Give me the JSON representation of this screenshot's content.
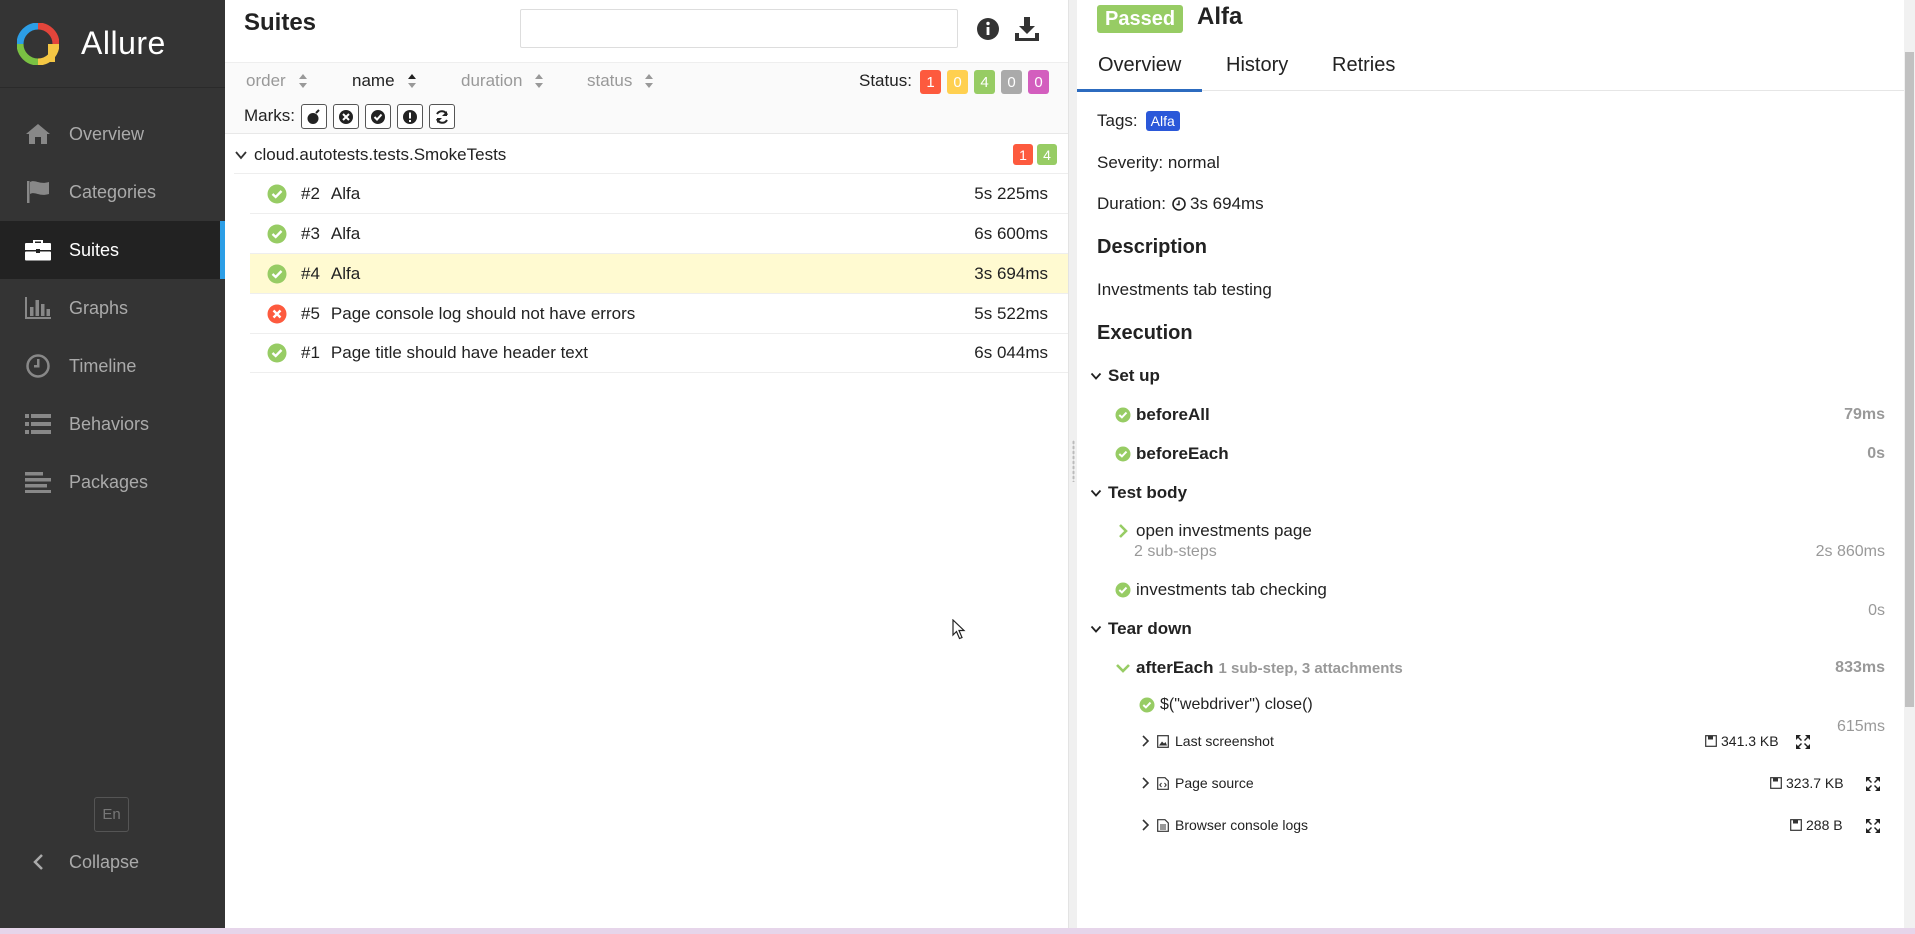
{
  "sidebar": {
    "brand": "Allure",
    "items": [
      {
        "label": "Overview",
        "icon": "home-icon"
      },
      {
        "label": "Categories",
        "icon": "flag-icon"
      },
      {
        "label": "Suites",
        "icon": "briefcase-icon",
        "active": true
      },
      {
        "label": "Graphs",
        "icon": "bar-chart-icon"
      },
      {
        "label": "Timeline",
        "icon": "clock-icon"
      },
      {
        "label": "Behaviors",
        "icon": "list-icon"
      },
      {
        "label": "Packages",
        "icon": "align-left-icon"
      }
    ],
    "language": "En",
    "collapse_label": "Collapse"
  },
  "suites": {
    "title": "Suites",
    "search": {
      "value": "",
      "placeholder": ""
    },
    "sort": {
      "order": "order",
      "name": "name",
      "duration": "duration",
      "status": "status"
    },
    "status_label": "Status:",
    "status_counts": [
      {
        "value": "1",
        "color": "#fd5a3e"
      },
      {
        "value": "0",
        "color": "#ffd050"
      },
      {
        "value": "4",
        "color": "#97cc64"
      },
      {
        "value": "0",
        "color": "#aaaaaa"
      },
      {
        "value": "0",
        "color": "#d35ebe"
      }
    ],
    "marks_label": "Marks:",
    "group": {
      "name": "cloud.autotests.tests.SmokeTests",
      "failed": "1",
      "passed": "4"
    },
    "rows": [
      {
        "num": "#2",
        "name": "Alfa",
        "duration": "5s 225ms",
        "status": "passed"
      },
      {
        "num": "#3",
        "name": "Alfa",
        "duration": "6s 600ms",
        "status": "passed"
      },
      {
        "num": "#4",
        "name": "Alfa",
        "duration": "3s 694ms",
        "status": "passed"
      },
      {
        "num": "#5",
        "name": "Page console log should not have errors",
        "duration": "5s 522ms",
        "status": "failed"
      },
      {
        "num": "#1",
        "name": "Page title should have header text",
        "duration": "6s 044ms",
        "status": "passed"
      }
    ]
  },
  "detail": {
    "status": "Passed",
    "title": "Alfa",
    "tabs": [
      "Overview",
      "History",
      "Retries"
    ],
    "tags_label": "Tags:",
    "tag": "Alfa",
    "severity": "Severity: normal",
    "duration_label": "Duration:",
    "duration": "3s 694ms",
    "description_heading": "Description",
    "description": "Investments tab testing",
    "execution_heading": "Execution",
    "setup": {
      "label": "Set up",
      "steps": [
        {
          "name": "beforeAll",
          "duration": "79ms"
        },
        {
          "name": "beforeEach",
          "duration": "0s"
        }
      ]
    },
    "body": {
      "label": "Test body",
      "steps": [
        {
          "name": "open investments page",
          "sub": "2 sub-steps",
          "duration": "2s 860ms"
        },
        {
          "name": "investments tab checking",
          "duration": "0s"
        }
      ]
    },
    "teardown": {
      "label": "Tear down",
      "step": {
        "name": "afterEach",
        "meta": "1 sub-step, 3 attachments",
        "duration": "833ms"
      },
      "substep": {
        "name": "$(\"webdriver\") close()",
        "duration": "615ms"
      },
      "attachments": [
        {
          "name": "Last screenshot",
          "size": "341.3 KB"
        },
        {
          "name": "Page source",
          "size": "323.7 KB"
        },
        {
          "name": "Browser console logs",
          "size": "288 B"
        }
      ]
    }
  }
}
